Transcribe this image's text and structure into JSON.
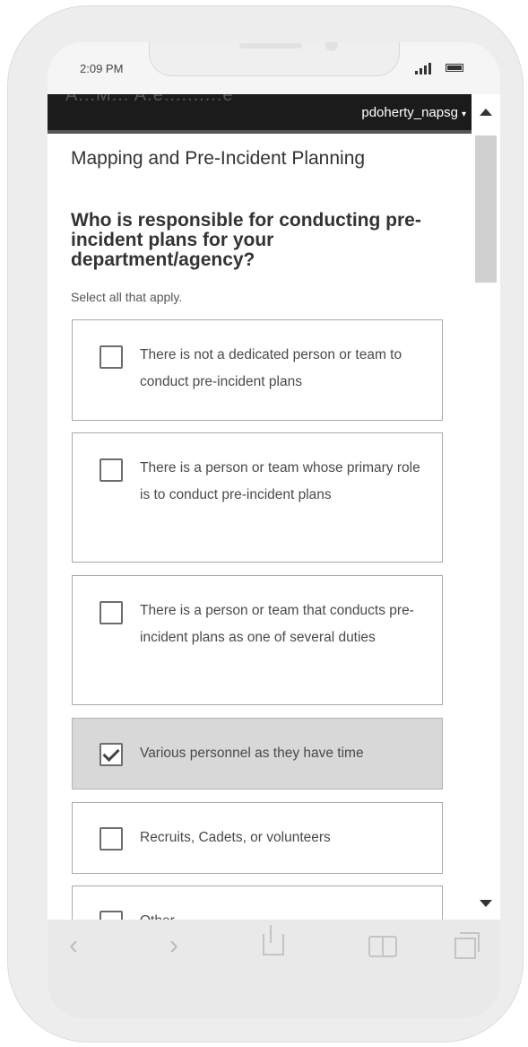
{
  "status_bar": {
    "time": "2:09 PM"
  },
  "header": {
    "cut_off_title": "A...M... A.e..........e",
    "username": "pdoherty_napsg",
    "caret": "▾"
  },
  "form": {
    "section_title": "Mapping and Pre-Incident Planning",
    "question": "Who is responsible for conducting pre-incident plans for your department/agency?",
    "hint": "Select all that apply.",
    "options": [
      {
        "label": "There is not a dedicated person or team to conduct pre-incident plans",
        "checked": false
      },
      {
        "label": "There is a person or team whose primary role is to conduct pre-incident plans",
        "checked": false
      },
      {
        "label": "There is a person or team that conducts pre-incident plans as one of several duties",
        "checked": false
      },
      {
        "label": "Various personnel as they have time",
        "checked": true
      },
      {
        "label": "Recruits, Cadets, or volunteers",
        "checked": false
      },
      {
        "label": "Other",
        "checked": false
      }
    ]
  },
  "toolbar": {
    "back": "‹",
    "forward": "›"
  },
  "icons": [
    "back-icon",
    "forward-icon",
    "share-icon",
    "bookmarks-icon",
    "tabs-icon",
    "checkbox-icon",
    "checkmark-icon"
  ]
}
